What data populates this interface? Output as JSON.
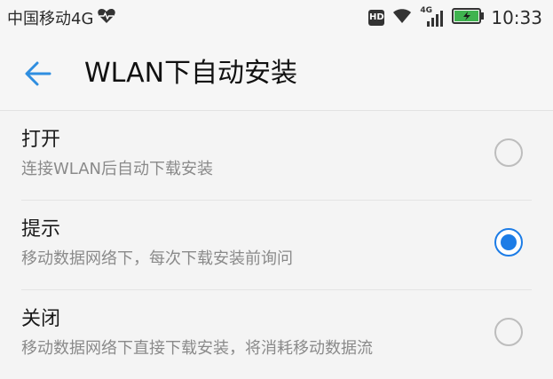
{
  "status_bar": {
    "carrier": "中国移动4G",
    "heart_icon": "heart-pulse-icon",
    "hd_label": "HD",
    "network_label": "4G",
    "time": "10:33"
  },
  "app_bar": {
    "title": "WLAN下自动安装",
    "back_icon": "arrow-left-icon",
    "accent_color": "#2f8ee0"
  },
  "options": [
    {
      "title": "打开",
      "subtitle": "连接WLAN后自动下载安装",
      "selected": false
    },
    {
      "title": "提示",
      "subtitle": "移动数据网络下，每次下载安装前询问",
      "selected": true
    },
    {
      "title": "关闭",
      "subtitle": "移动数据网络下直接下载安装，将消耗移动数据流",
      "selected": false
    }
  ],
  "colors": {
    "radio_selected": "#1c7ce6",
    "radio_unselected": "#bdbdbd"
  }
}
